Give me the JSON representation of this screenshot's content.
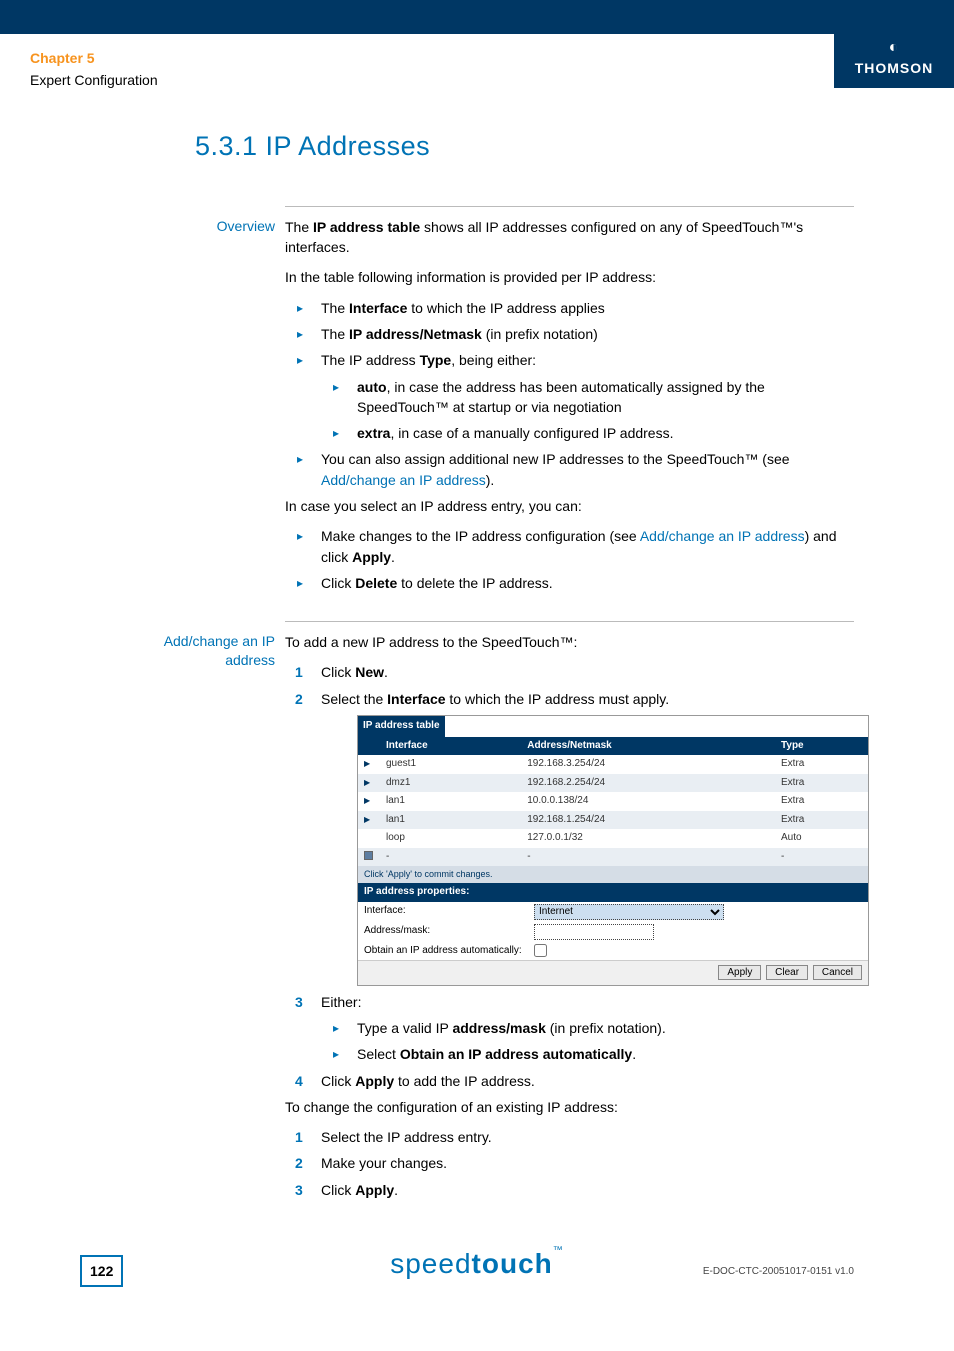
{
  "header": {
    "chapter": "Chapter 5",
    "subtitle": "Expert Configuration",
    "brand": "THOMSON"
  },
  "title": "5.3.1  IP Addresses",
  "overview": {
    "label": "Overview",
    "intro_1": "The ",
    "intro_bold": "IP address table",
    "intro_2": " shows all IP addresses configured on any of SpeedTouch™'s interfaces.",
    "line2": "In the table following information is provided per IP address:",
    "b1_a": "The ",
    "b1_b": "Interface",
    "b1_c": " to which the IP address applies",
    "b2_a": "The ",
    "b2_b": "IP address/Netmask",
    "b2_c": " (in prefix notation)",
    "b3_a": "The IP address ",
    "b3_b": "Type",
    "b3_c": ", being either:",
    "b3s1_a": "auto",
    "b3s1_b": ", in case the address has been automatically assigned by the SpeedTouch™ at startup or via negotiation",
    "b3s2_a": "extra",
    "b3s2_b": ", in case of a manually configured IP address.",
    "b4_a": "You can also assign additional new IP addresses to the SpeedTouch™ (see ",
    "b4_link": "Add/change an IP address",
    "b4_c": ").",
    "line3": "In case you select an IP address entry, you can:",
    "b5_a": "Make changes to the IP address configuration (see ",
    "b5_link": "Add/change an IP address",
    "b5_c": ") and click ",
    "b5_d": "Apply",
    "b5_e": ".",
    "b6_a": "Click ",
    "b6_b": "Delete",
    "b6_c": " to delete the IP address."
  },
  "addchange": {
    "label": "Add/change an IP address",
    "intro": "To add a new IP address to the SpeedTouch™:",
    "s1_a": "Click ",
    "s1_b": "New",
    "s1_c": ".",
    "s2_a": "Select the ",
    "s2_b": "Interface",
    "s2_c": " to which the IP address must apply.",
    "s3": "Either:",
    "s3b1_a": "Type a valid IP ",
    "s3b1_b": "address/mask",
    "s3b1_c": " (in prefix notation).",
    "s3b2_a": "Select ",
    "s3b2_b": "Obtain an IP address automatically",
    "s3b2_c": ".",
    "s4_a": "Click ",
    "s4_b": "Apply",
    "s4_c": " to add the IP address.",
    "line2": "To change the configuration of an existing IP address:",
    "c1": "Select the IP address entry.",
    "c2": "Make your changes.",
    "c3_a": "Click ",
    "c3_b": "Apply",
    "c3_c": "."
  },
  "embed": {
    "caption": "IP address table",
    "th1": "Interface",
    "th2": "Address/Netmask",
    "th3": "Type",
    "rows": [
      {
        "iface": "guest1",
        "addr": "192.168.3.254/24",
        "type": "Extra"
      },
      {
        "iface": "dmz1",
        "addr": "192.168.2.254/24",
        "type": "Extra"
      },
      {
        "iface": "lan1",
        "addr": "10.0.0.138/24",
        "type": "Extra"
      },
      {
        "iface": "lan1",
        "addr": "192.168.1.254/24",
        "type": "Extra"
      },
      {
        "iface": "loop",
        "addr": "127.0.0.1/32",
        "type": "Auto"
      },
      {
        "iface": "-",
        "addr": "-",
        "type": "-"
      }
    ],
    "note": "Click 'Apply' to commit changes.",
    "props_hdr": "IP address properties:",
    "f_iface": "Interface:",
    "f_iface_val": "Internet",
    "f_addr": "Address/mask:",
    "f_auto": "Obtain an IP address automatically:",
    "btn_apply": "Apply",
    "btn_clear": "Clear",
    "btn_cancel": "Cancel"
  },
  "footer": {
    "page": "122",
    "product_a": "speed",
    "product_b": "touch",
    "tm": "™",
    "docid": "E-DOC-CTC-20051017-0151 v1.0"
  }
}
